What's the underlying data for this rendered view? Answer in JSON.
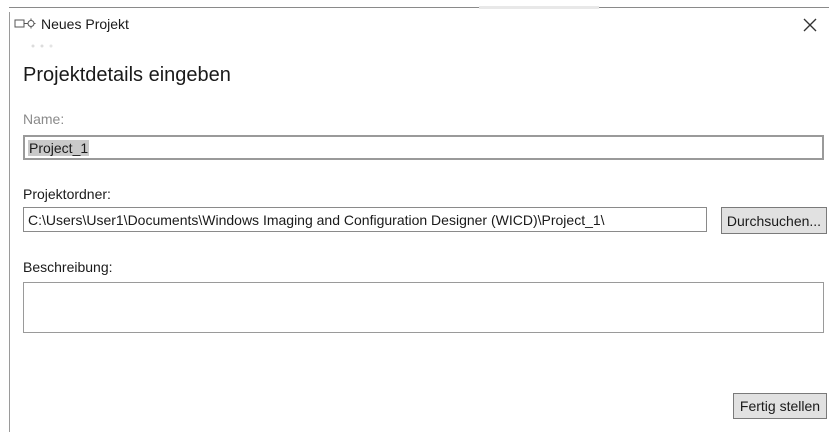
{
  "window": {
    "title": "Neues Projekt",
    "icon": "wicd-app-icon",
    "close_icon": "close-icon"
  },
  "page": {
    "heading": "Projektdetails eingeben"
  },
  "name_field": {
    "label": "Name:",
    "value": "Project_1"
  },
  "folder_field": {
    "label": "Projektordner:",
    "value": "C:\\Users\\User1\\Documents\\Windows Imaging and Configuration Designer (WICD)\\Project_1\\"
  },
  "browse_button": {
    "label": "Durchsuchen..."
  },
  "description_field": {
    "label": "Beschreibung:",
    "value": ""
  },
  "finish_button": {
    "label": "Fertig stellen"
  },
  "colors": {
    "selection": "#c9c9c9",
    "button_bg": "#e1e1e1",
    "border": "#9a9a9a",
    "disabled_label": "#8a8a8a"
  }
}
